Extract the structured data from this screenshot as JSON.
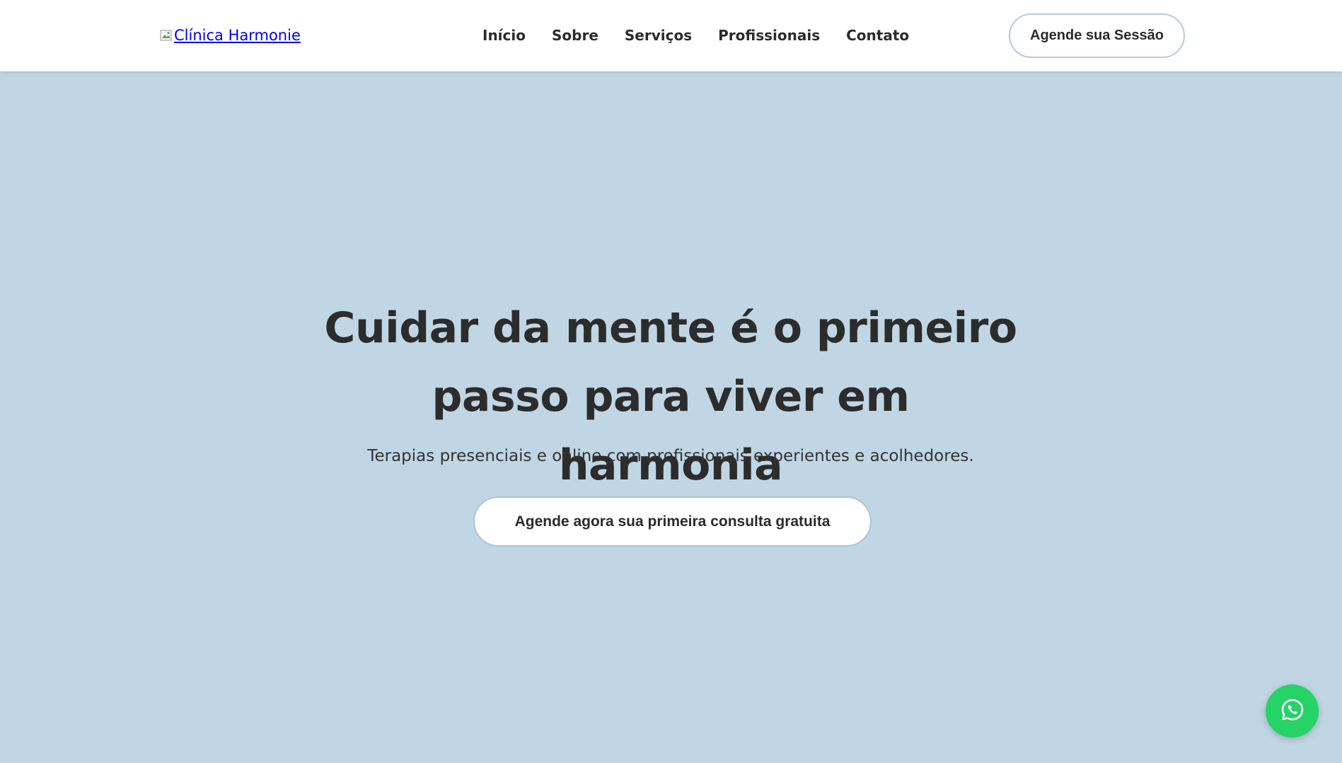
{
  "header": {
    "logo_alt": "Clínica Harmonie",
    "nav": [
      {
        "label": "Início"
      },
      {
        "label": "Sobre"
      },
      {
        "label": "Serviços"
      },
      {
        "label": "Profissionais"
      },
      {
        "label": "Contato"
      }
    ],
    "cta_label": "Agende sua Sessão"
  },
  "hero": {
    "title_line1": "Cuidar da mente é o primeiro",
    "title_line2": "passo para viver em harmonia",
    "subtitle": "Terapias presenciais e online com profissionais experientes e acolhedores.",
    "cta_label": "Agende agora sua primeira consulta gratuita"
  },
  "floating": {
    "whatsapp_icon": "whatsapp-icon"
  },
  "colors": {
    "hero_bg": "#c0d6e4",
    "header_bg": "#ffffff",
    "text": "#2c2c2c",
    "whatsapp": "#25d366"
  }
}
